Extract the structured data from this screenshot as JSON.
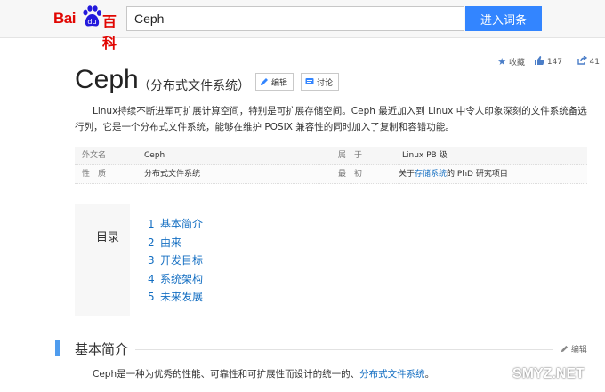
{
  "header": {
    "logo_text_1": "Bai",
    "logo_text_2": "百科",
    "search_value": "Ceph",
    "search_button": "进入词条"
  },
  "stats": {
    "favorite_label": "收藏",
    "likes": "147",
    "shares": "41"
  },
  "entry": {
    "title": "Ceph",
    "subtitle": "（分布式文件系统）",
    "edit_label": "编辑",
    "discuss_label": "讨论",
    "summary": "Linux持续不断进军可扩展计算空间，特别是可扩展存储空间。Ceph 最近加入到 Linux 中令人印象深刻的文件系统备选行列，它是一个分布式文件系统，能够在维护 POSIX 兼容性的同时加入了复制和容错功能。"
  },
  "infobox": {
    "rows": [
      {
        "l1": "外文名",
        "v1": "Ceph",
        "l2": "属　于",
        "v2": "Linux PB 级"
      },
      {
        "l1": "性　质",
        "v1": "分布式文件系统",
        "l2": "最　初",
        "v2_pre": "关于",
        "v2_link": "存储系统",
        "v2_post": "的 PhD 研究项目"
      }
    ]
  },
  "toc": {
    "title": "目录",
    "items": [
      {
        "num": "1",
        "label": "基本简介"
      },
      {
        "num": "2",
        "label": "由来"
      },
      {
        "num": "3",
        "label": "开发目标"
      },
      {
        "num": "4",
        "label": "系统架构"
      },
      {
        "num": "5",
        "label": "未来发展"
      }
    ]
  },
  "section": {
    "title": "基本简介",
    "edit_label": "编辑",
    "text_pre": "Ceph是一种为优秀的性能、可靠性和可扩展性而设计的统一的、",
    "text_link": "分布式文件系统",
    "text_post": "。"
  },
  "watermark": "SMYZ.NET",
  "colors": {
    "brand_red": "#e10602",
    "accent_blue": "#3385ff",
    "link": "#136ec2"
  }
}
